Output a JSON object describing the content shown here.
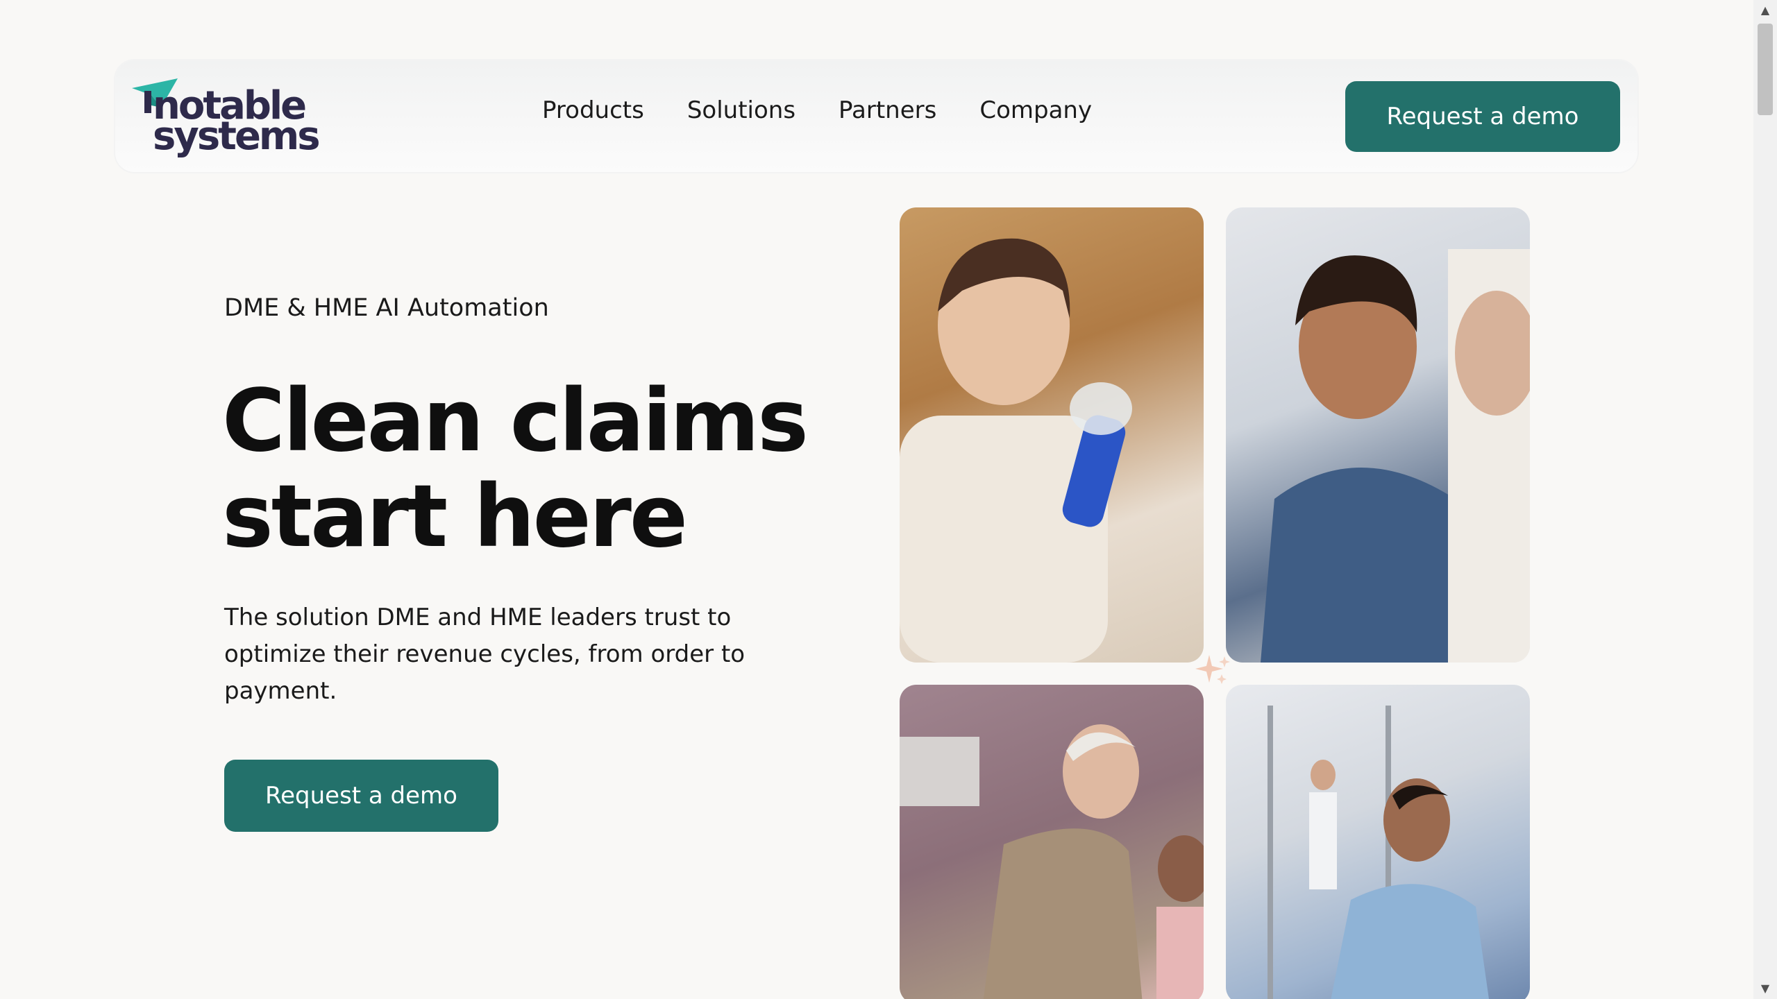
{
  "brand": {
    "line1": "notable",
    "line2": "systems",
    "primary_color": "#23716b",
    "logo_text_color": "#2e2a4b"
  },
  "nav": {
    "items": [
      {
        "label": "Products"
      },
      {
        "label": "Solutions"
      },
      {
        "label": "Partners"
      },
      {
        "label": "Company"
      }
    ],
    "cta_label": "Request a demo"
  },
  "hero": {
    "eyebrow": "DME & HME AI Automation",
    "headline_line1": "Clean claims",
    "headline_line2": "start here",
    "subtext": "The solution DME and HME leaders trust to optimize their revenue cycles, from order to payment.",
    "cta_label": "Request a demo"
  },
  "icons": {
    "logo": "paper-plane-icon",
    "sparkle": "sparkle-icon"
  }
}
